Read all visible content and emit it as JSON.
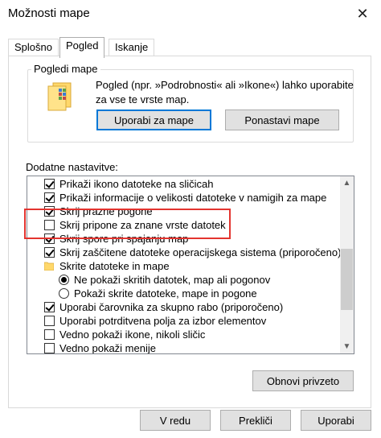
{
  "window": {
    "title": "Možnosti mape",
    "close_glyph": "✕"
  },
  "tabs": [
    {
      "label": "Splošno"
    },
    {
      "label": "Pogled"
    },
    {
      "label": "Iskanje"
    }
  ],
  "folder_views": {
    "legend": "Pogledi mape",
    "description": "Pogled (npr. »Podrobnosti« ali »Ikone«) lahko uporabite za vse te vrste map.",
    "apply_button": "Uporabi za mape",
    "reset_button": "Ponastavi mape",
    "icon": "folder-icon"
  },
  "advanced": {
    "label": "Dodatne nastavitve:",
    "items": [
      {
        "type": "checkbox",
        "checked": true,
        "label": "Prikaži ikono datoteke na sličicah"
      },
      {
        "type": "checkbox",
        "checked": true,
        "label": "Prikaži informacije o velikosti datoteke v namigih za mape"
      },
      {
        "type": "checkbox",
        "checked": true,
        "label": "Skrij prazne pogone"
      },
      {
        "type": "checkbox",
        "checked": false,
        "label": "Skrij pripone za znane vrste datotek"
      },
      {
        "type": "checkbox",
        "checked": true,
        "label": "Skrij spore pri spajanju map"
      },
      {
        "type": "checkbox",
        "checked": true,
        "label": "Skrij zaščitene datoteke operacijskega sistema (priporočeno)"
      },
      {
        "type": "folder",
        "label": "Skrite datoteke in mape"
      },
      {
        "type": "radio",
        "checked": true,
        "label": "Ne pokaži skritih datotek, map ali pogonov"
      },
      {
        "type": "radio",
        "checked": false,
        "label": "Pokaži skrite datoteke, mape in pogone"
      },
      {
        "type": "checkbox",
        "checked": true,
        "label": "Uporabi čarovnika za skupno rabo (priporočeno)"
      },
      {
        "type": "checkbox",
        "checked": false,
        "label": "Uporabi potrditvena polja za izbor elementov"
      },
      {
        "type": "checkbox",
        "checked": false,
        "label": "Vedno pokaži ikone, nikoli sličic"
      },
      {
        "type": "checkbox",
        "checked": false,
        "label": "Vedno pokaži menije"
      }
    ],
    "restore_button": "Obnovi privzeto"
  },
  "footer": {
    "ok_button": "V redu",
    "cancel_button": "Prekliči",
    "apply_button": "Uporabi"
  },
  "colors": {
    "highlight": "#e3342f",
    "accent": "#0078d7"
  }
}
